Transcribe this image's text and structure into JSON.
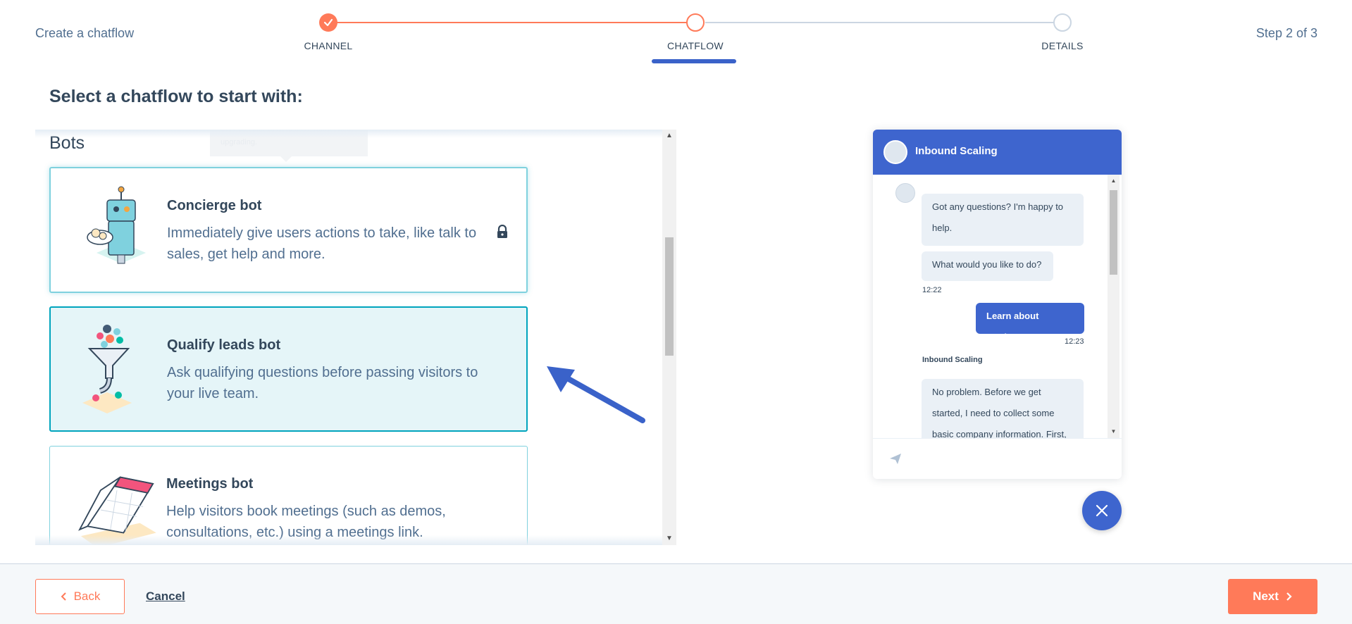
{
  "header": {
    "title": "Create a chatflow",
    "step_count": "Step 2 of 3",
    "steps": [
      {
        "label": "CHANNEL",
        "state": "complete"
      },
      {
        "label": "CHATFLOW",
        "state": "current"
      },
      {
        "label": "DETAILS",
        "state": "upcoming"
      }
    ]
  },
  "main": {
    "title": "Select a chatflow to start with:",
    "section_heading": "Bots",
    "tooltip": "Knowledge Center is available in Service Hub. Click to learn more about upgrading.",
    "cards": [
      {
        "title": "Concierge bot",
        "description": "Immediately give users actions to take, like talk to sales, get help and more.",
        "icon": "robot-waiter-illustration",
        "locked": true
      },
      {
        "title": "Qualify leads bot",
        "description": "Ask qualifying questions before passing visitors to your live team.",
        "icon": "funnel-illustration",
        "selected": true
      },
      {
        "title": "Meetings bot",
        "description": "Help visitors book meetings (such as demos, consultations, etc.) using a meetings link.",
        "icon": "calendar-illustration"
      }
    ]
  },
  "chat_preview": {
    "title": "Inbound Scaling",
    "messages": {
      "bot_1": "Got any questions? I'm happy to help.",
      "bot_2": "What would you like to do?",
      "time_1": "12:22",
      "user_1": "Learn about products",
      "time_2": "12:23",
      "sender": "Inbound Scaling",
      "bot_3": "No problem. Before we get started, I need to collect some basic company information. First,"
    }
  },
  "footer": {
    "back_label": "Back",
    "cancel_label": "Cancel",
    "next_label": "Next"
  },
  "colors": {
    "accent_orange": "#ff7a59",
    "accent_blue": "#3e65ce",
    "teal_border": "#00a4bd",
    "text_dark": "#33475b"
  }
}
